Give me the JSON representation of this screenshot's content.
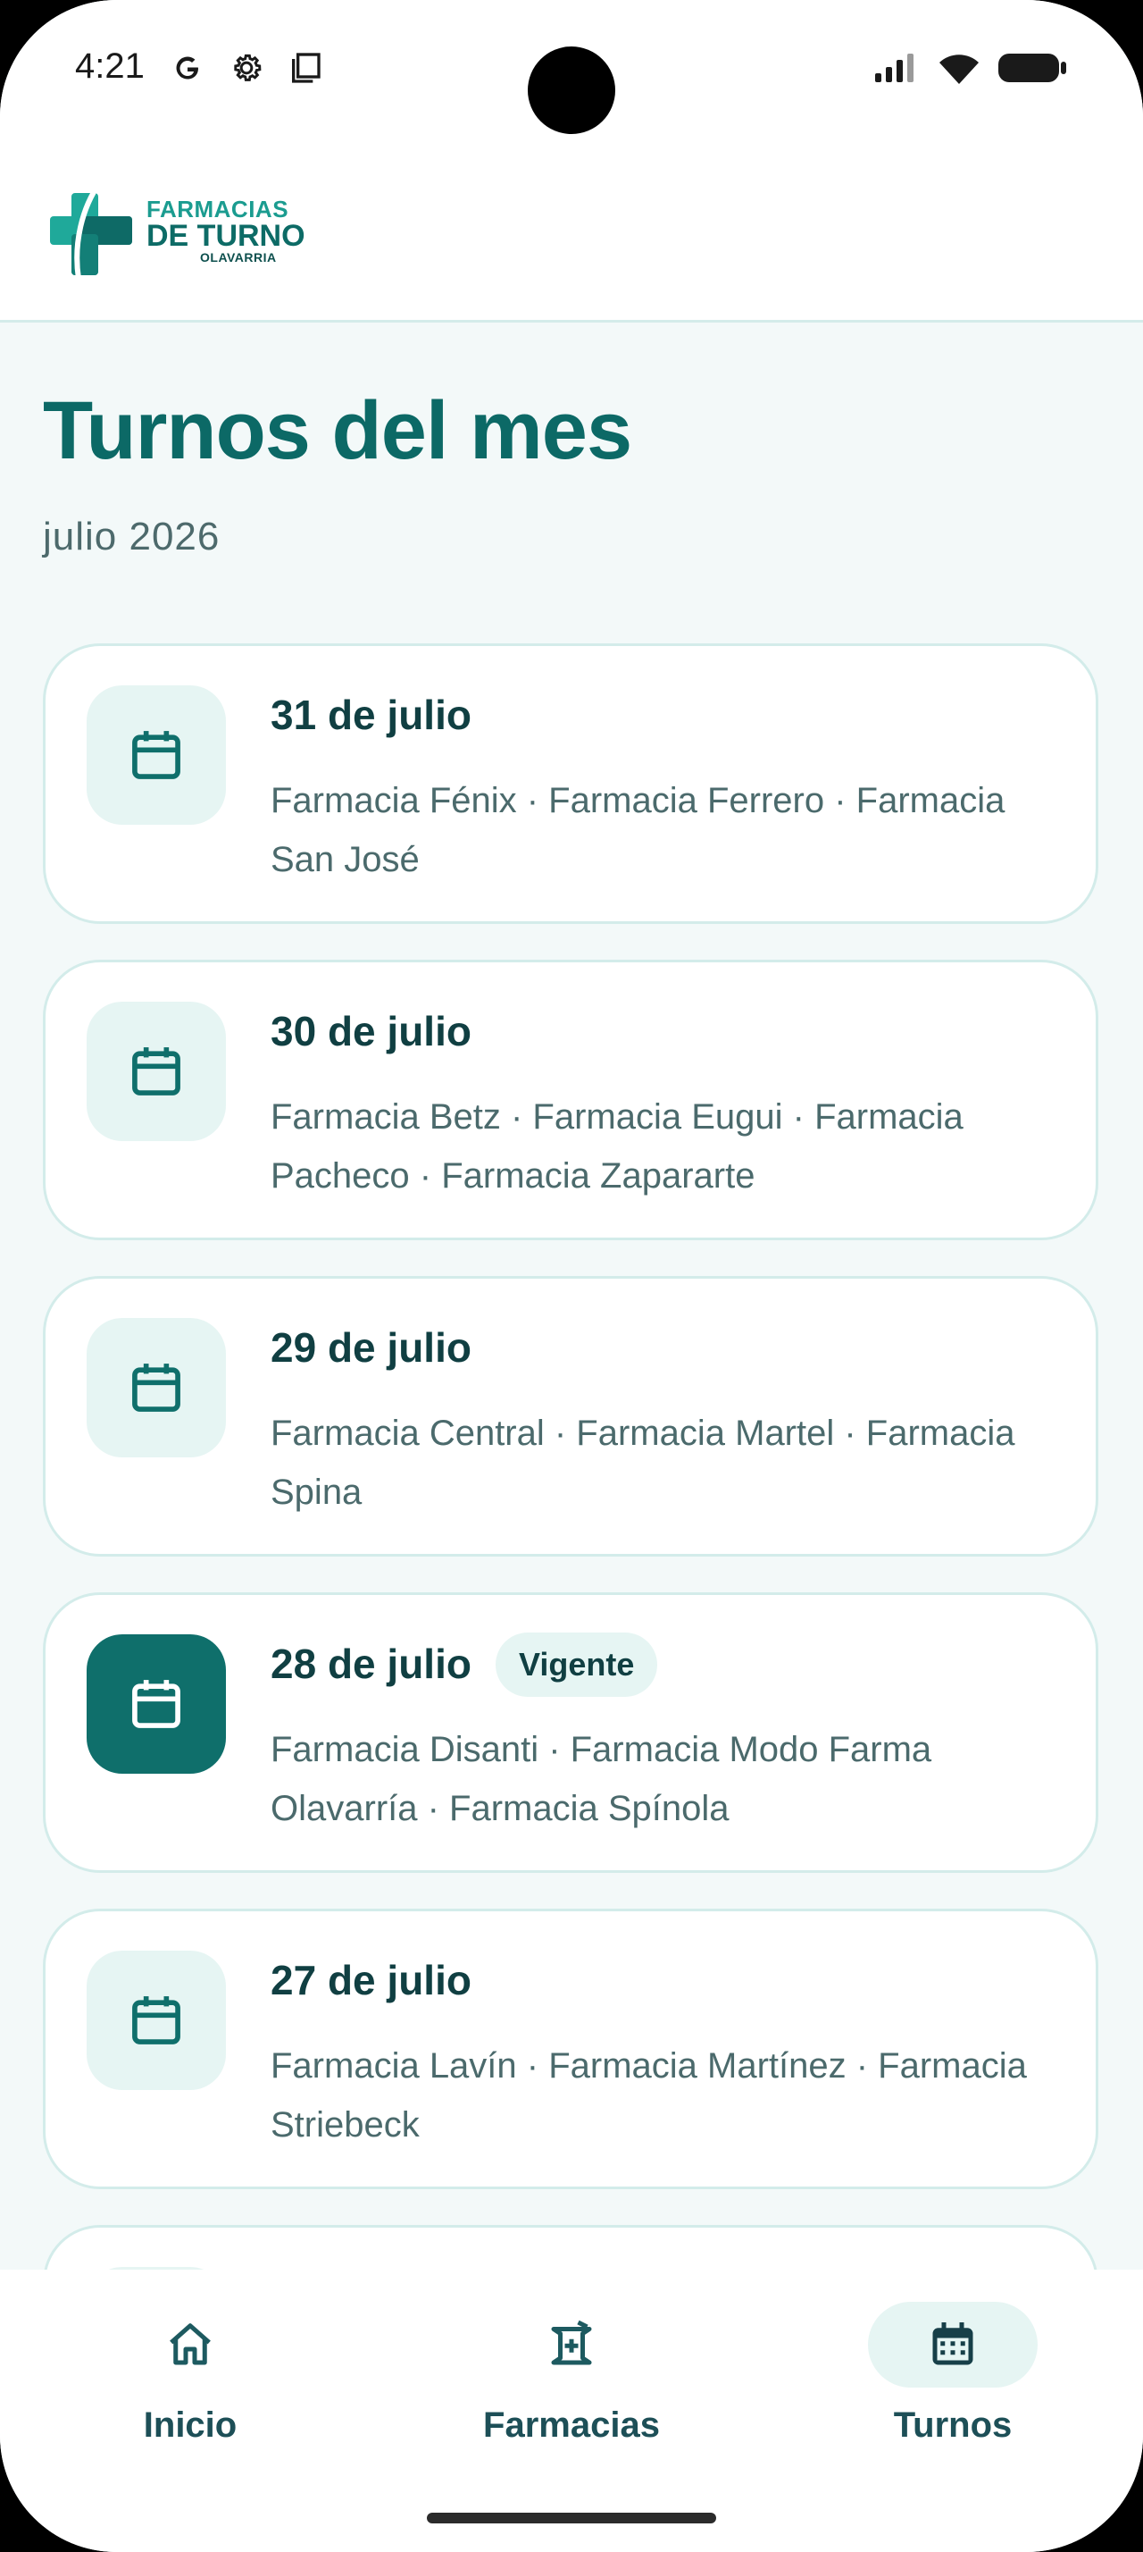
{
  "status": {
    "time": "4:21"
  },
  "header": {
    "logo_line1": "FARMACIAS",
    "logo_line2": "DE TURNO",
    "logo_line3": "OLAVARRIA"
  },
  "page": {
    "title": "Turnos del mes",
    "month": "julio 2026"
  },
  "turnos": [
    {
      "date": "31 de julio",
      "pharmacies": "Farmacia Fénix · Farmacia Ferrero · Farmacia San José",
      "active": false
    },
    {
      "date": "30 de julio",
      "pharmacies": "Farmacia Betz · Farmacia Eugui · Farmacia Pacheco · Farmacia Zapararte",
      "active": false
    },
    {
      "date": "29 de julio",
      "pharmacies": "Farmacia Central · Farmacia Martel · Farmacia Spina",
      "active": false
    },
    {
      "date": "28 de julio",
      "pharmacies": "Farmacia Disanti · Farmacia Modo Farma Olavarría · Farmacia Spínola",
      "active": true,
      "badge": "Vigente"
    },
    {
      "date": "27 de julio",
      "pharmacies": "Farmacia Lavín · Farmacia Martínez · Farmacia Striebeck",
      "active": false
    }
  ],
  "nav": [
    {
      "label": "Inicio",
      "icon": "home-icon",
      "active": false
    },
    {
      "label": "Farmacias",
      "icon": "pharmacy-icon",
      "active": false
    },
    {
      "label": "Turnos",
      "icon": "calendar-icon",
      "active": true
    }
  ],
  "colors": {
    "accent": "#0f6f6b",
    "accent_light": "#e6f5f3",
    "background": "#f3f9f9"
  }
}
